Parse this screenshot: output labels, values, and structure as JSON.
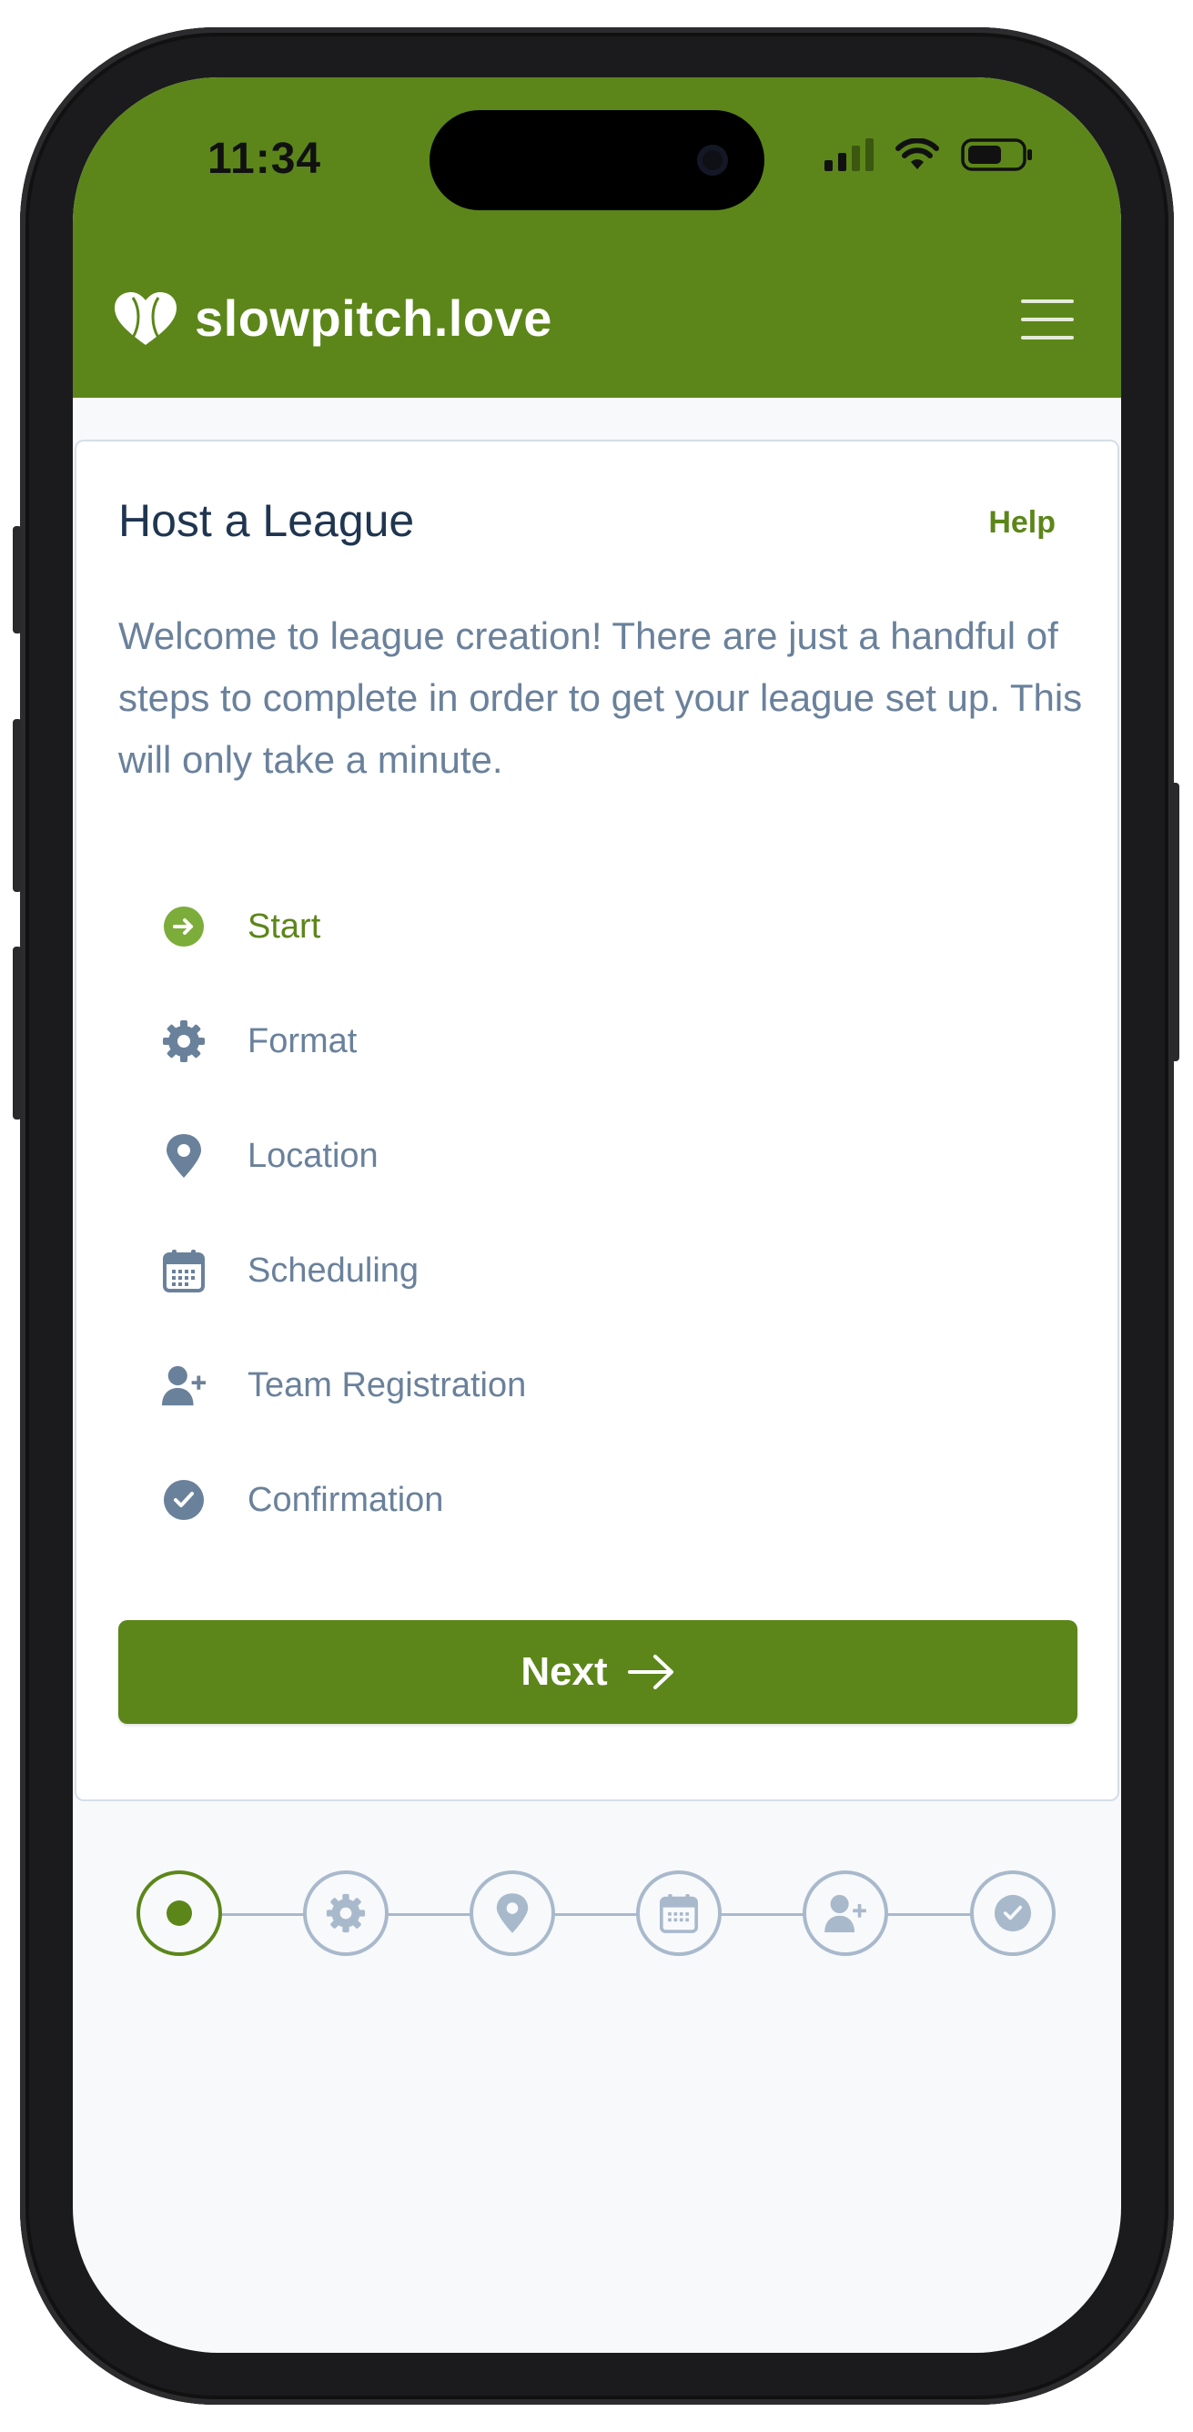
{
  "status_bar": {
    "time": "11:34"
  },
  "header": {
    "brand": "slowpitch.love",
    "logo_icon": "baseball-heart-icon",
    "menu_icon": "hamburger-menu-icon"
  },
  "card": {
    "title": "Host a League",
    "help_label": "Help",
    "intro": "Welcome to league creation! There are just a handful of steps to complete in order to get your league set up. This will only take a minute."
  },
  "steps": [
    {
      "label": "Start",
      "icon": "arrow-right-circle-icon",
      "active": true
    },
    {
      "label": "Format",
      "icon": "gear-icon",
      "active": false
    },
    {
      "label": "Location",
      "icon": "map-pin-icon",
      "active": false
    },
    {
      "label": "Scheduling",
      "icon": "calendar-icon",
      "active": false
    },
    {
      "label": "Team Registration",
      "icon": "user-plus-icon",
      "active": false
    },
    {
      "label": "Confirmation",
      "icon": "check-circle-icon",
      "active": false
    }
  ],
  "next_button": {
    "label": "Next",
    "icon": "arrow-right-icon"
  },
  "progress": {
    "current_step": 1,
    "total_steps": 6
  },
  "colors": {
    "brand_green": "#5c861a",
    "active_step_green": "#7cac3a",
    "muted_blue": "#6a819b",
    "title_navy": "#1f3550",
    "stepper_gray": "#a9b9cc"
  }
}
